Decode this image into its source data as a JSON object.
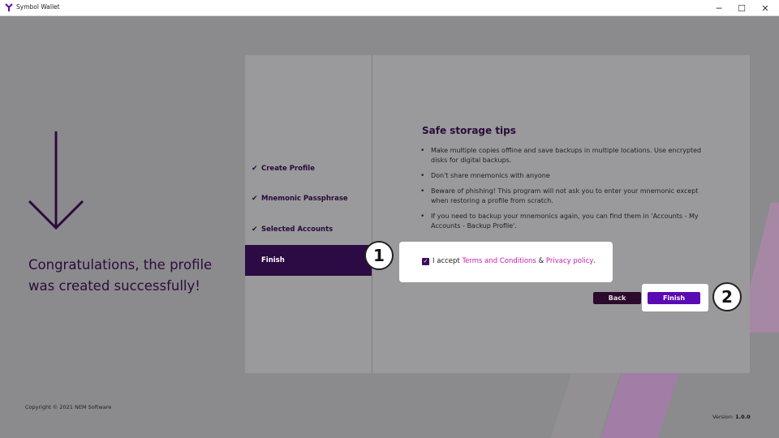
{
  "window": {
    "title": "Symbol Wallet",
    "controls": {
      "minimize": "─",
      "maximize": "☐",
      "close": "✕"
    }
  },
  "hero": {
    "message": "Congratulations, the profile was created successfully!"
  },
  "steps": [
    {
      "label": "Create Profile",
      "done": true
    },
    {
      "label": "Mnemonic Passphrase",
      "done": true
    },
    {
      "label": "Selected Accounts",
      "done": true
    },
    {
      "label": "Finish",
      "done": false,
      "active": true
    }
  ],
  "tips": {
    "title": "Safe storage tips",
    "items": [
      "Make multiple copies offline and save backups in multiple locations. Use encrypted disks for digital backups.",
      "Don't share mnemonics with anyone",
      "Beware of phishing! This program will not ask you to enter your mnemonic except when restoring a profile from scratch.",
      "If you need to backup your mnemonics again, you can find them in 'Accounts - My Accounts - Backup Profile'."
    ]
  },
  "agreement": {
    "prefix": "I accept",
    "terms_link": "Terms and Conditions",
    "separator": "&",
    "privacy_link": "Privacy policy",
    "suffix": ".",
    "checked": true
  },
  "buttons": {
    "back": "Back",
    "finish": "Finish"
  },
  "annotations": {
    "first": "1",
    "second": "2"
  },
  "footer": {
    "copyright": "Copyright © 2021 NEM Software",
    "version_label": "Version:",
    "version_value": "1.0.0"
  },
  "colors": {
    "brand_dark": "#2c0a43",
    "brand_purple": "#5b0bb3",
    "link_pink": "#c01fb4"
  }
}
